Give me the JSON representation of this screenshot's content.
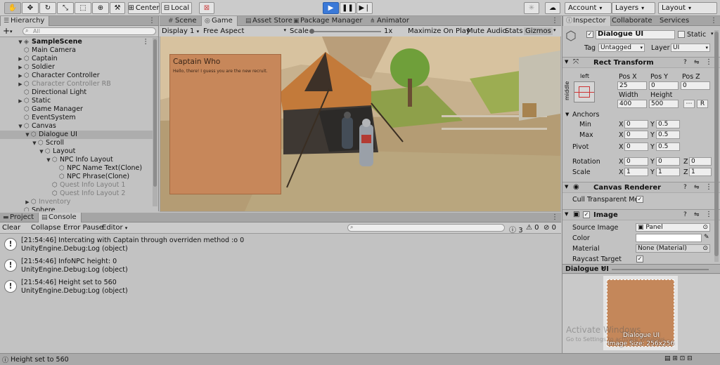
{
  "toolbar": {
    "tools": [
      "hand-tool-icon",
      "move-tool-icon",
      "rotate-tool-icon",
      "scale-tool-icon",
      "rect-tool-icon",
      "transform-tool-icon",
      "custom-tool-icon"
    ],
    "pivot_mode": "Center",
    "pivot_rotation": "Local",
    "account": "Account",
    "layers": "Layers",
    "layout": "Layout"
  },
  "hierarchy": {
    "tab": "Hierarchy",
    "add": "+",
    "search_placeholder": "All",
    "rows": [
      {
        "label": "SampleScene",
        "depth": 0,
        "arrow": "down",
        "icon": "unity-scene-icon",
        "bold": true,
        "state": "normal"
      },
      {
        "label": "Main Camera",
        "depth": 1,
        "arrow": "",
        "icon": "cube-icon",
        "state": "normal"
      },
      {
        "label": "Captain",
        "depth": 1,
        "arrow": "right",
        "icon": "cube-icon",
        "state": "normal"
      },
      {
        "label": "Soldier",
        "depth": 1,
        "arrow": "right",
        "icon": "cube-icon",
        "state": "normal"
      },
      {
        "label": "Character Controller",
        "depth": 1,
        "arrow": "right",
        "icon": "cube-icon",
        "state": "normal"
      },
      {
        "label": "Character Controller RB",
        "depth": 1,
        "arrow": "right",
        "icon": "cube-icon",
        "state": "dim"
      },
      {
        "label": "Directional Light",
        "depth": 1,
        "arrow": "",
        "icon": "cube-icon",
        "state": "normal"
      },
      {
        "label": "Static",
        "depth": 1,
        "arrow": "right",
        "icon": "cube-icon",
        "state": "normal"
      },
      {
        "label": "Game Manager",
        "depth": 1,
        "arrow": "",
        "icon": "cube-icon",
        "state": "normal"
      },
      {
        "label": "EventSystem",
        "depth": 1,
        "arrow": "",
        "icon": "cube-icon",
        "state": "normal"
      },
      {
        "label": "Canvas",
        "depth": 1,
        "arrow": "down",
        "icon": "cube-icon",
        "state": "normal"
      },
      {
        "label": "Dialogue UI",
        "depth": 2,
        "arrow": "down",
        "icon": "cube-icon",
        "state": "selected"
      },
      {
        "label": "Scroll",
        "depth": 3,
        "arrow": "down",
        "icon": "cube-icon",
        "state": "normal"
      },
      {
        "label": "Layout",
        "depth": 4,
        "arrow": "down",
        "icon": "cube-icon",
        "state": "normal"
      },
      {
        "label": "NPC Info Layout",
        "depth": 5,
        "arrow": "down",
        "icon": "cube-icon",
        "state": "normal"
      },
      {
        "label": "NPC Name Text(Clone)",
        "depth": 6,
        "arrow": "",
        "icon": "cube-icon",
        "state": "normal"
      },
      {
        "label": "NPC Phrase(Clone)",
        "depth": 6,
        "arrow": "",
        "icon": "cube-icon",
        "state": "normal"
      },
      {
        "label": "Quest Info Layout 1",
        "depth": 5,
        "arrow": "",
        "icon": "cube-icon",
        "state": "dim"
      },
      {
        "label": "Quest Info Layout 2",
        "depth": 5,
        "arrow": "",
        "icon": "cube-icon",
        "state": "dim"
      },
      {
        "label": "Inventory",
        "depth": 2,
        "arrow": "right",
        "icon": "cube-icon",
        "state": "dim"
      },
      {
        "label": "Sphere",
        "depth": 1,
        "arrow": "",
        "icon": "cube-icon",
        "state": "normal"
      }
    ]
  },
  "center_tabs": {
    "scene": "Scene",
    "game": "Game",
    "asset_store": "Asset Store",
    "package_manager": "Package Manager",
    "animator": "Animator"
  },
  "game_bar": {
    "display": "Display 1",
    "aspect": "Free Aspect",
    "scale_label": "Scale",
    "scale_value": "1x",
    "maximize": "Maximize On Play",
    "mute": "Mute Audio",
    "stats": "Stats",
    "gizmos": "Gizmos"
  },
  "dialogue": {
    "title": "Captain Who",
    "phrase": "Hello, there! I guess you are the new recruit."
  },
  "bottom_tabs": {
    "project": "Project",
    "console": "Console"
  },
  "console_bar": {
    "clear": "Clear",
    "collapse": "Collapse",
    "error_pause": "Error Pause",
    "editor": "Editor",
    "count_log": "3",
    "count_warn": "0",
    "count_error": "0"
  },
  "console": {
    "entries": [
      {
        "line1": "[21:54:46] Intercating with Captain through overriden method :o 0",
        "line2": "UnityEngine.Debug:Log (object)"
      },
      {
        "line1": "[21:54:46] InfoNPC height: 0",
        "line2": "UnityEngine.Debug:Log (object)"
      },
      {
        "line1": "[21:54:46] Height set to 560",
        "line2": "UnityEngine.Debug:Log (object)"
      }
    ]
  },
  "status_bar": {
    "message": "Height set to 560"
  },
  "inspector": {
    "tabs": {
      "inspector": "Inspector",
      "collaborate": "Collaborate",
      "services": "Services"
    },
    "object_name": "Dialogue UI",
    "static_label": "Static",
    "tag_label": "Tag",
    "tag_value": "Untagged",
    "layer_label": "Layer",
    "layer_value": "UI",
    "rect_transform": {
      "title": "Rect Transform",
      "anchor_h": "left",
      "anchor_v": "middle",
      "pos_x_label": "Pos X",
      "pos_y_label": "Pos Y",
      "pos_z_label": "Pos Z",
      "pos_x": "25",
      "pos_y": "0",
      "pos_z": "0",
      "width_label": "Width",
      "height_label": "Height",
      "width": "400",
      "height": "500",
      "r_button": "R",
      "anchors_label": "Anchors",
      "min_label": "Min",
      "max_label": "Max",
      "min_x": "0",
      "min_y": "0.5",
      "max_x": "0",
      "max_y": "0.5",
      "pivot_label": "Pivot",
      "pivot_x": "0",
      "pivot_y": "0.5",
      "rotation_label": "Rotation",
      "rot_x": "0",
      "rot_y": "0",
      "rot_z": "0",
      "scale_label": "Scale",
      "scale_x": "1",
      "scale_y": "1",
      "scale_z": "1",
      "x": "X",
      "y": "Y",
      "z": "Z"
    },
    "canvas_renderer": {
      "title": "Canvas Renderer",
      "cull_label": "Cull Transparent Mes"
    },
    "image": {
      "title": "Image",
      "source_label": "Source Image",
      "source_value": "Panel",
      "color_label": "Color",
      "material_label": "Material",
      "material_value": "None (Material)",
      "raycast_label": "Raycast Target"
    },
    "preview": {
      "title": "Dialogue UI",
      "caption1": "Dialogue UI",
      "caption2": "Image Size: 256x256"
    }
  },
  "watermark": {
    "line1": "Activate Windows",
    "line2": "Go to Settings to activate Windows."
  },
  "colors": {
    "accent": "#3a79d8",
    "dialog": "#c7875a",
    "panel": "#c2c2c2"
  }
}
